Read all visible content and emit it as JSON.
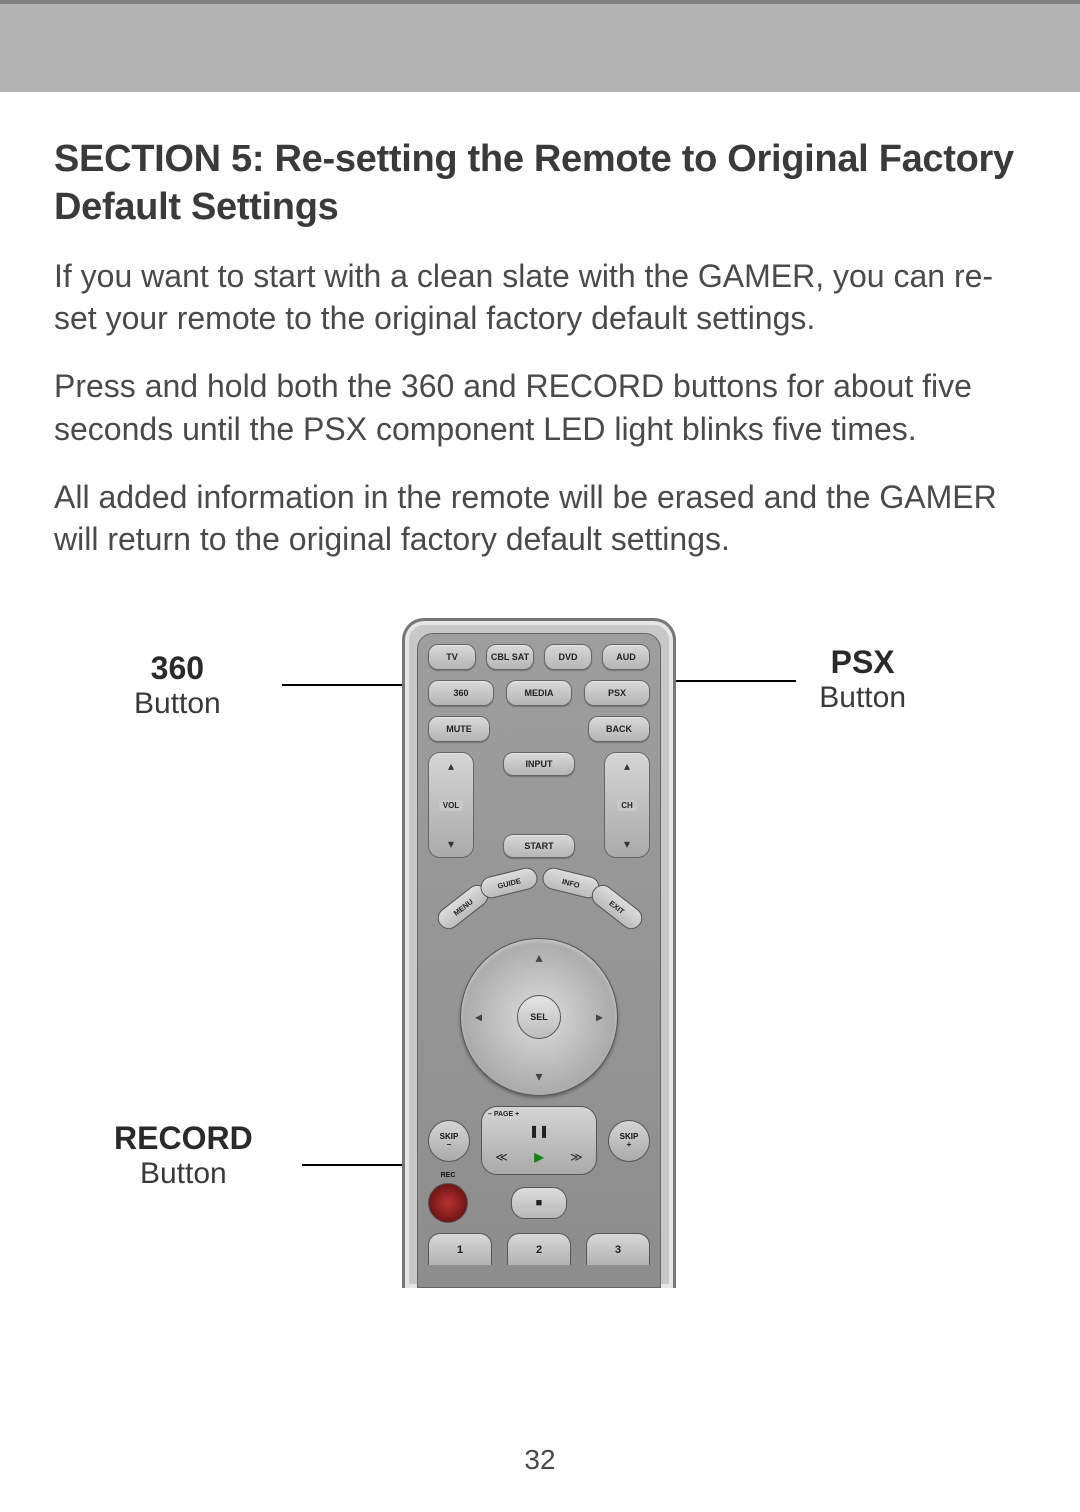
{
  "heading": "SECTION 5: Re-setting the Remote to Original Factory Default Settings",
  "para1": "If you want to start with a clean slate with the GAMER, you can re-set your remote to the original factory default settings.",
  "para2": "Press and hold both the 360 and RECORD buttons for about five seconds until the PSX component LED light blinks five times.",
  "para3": "All added information in the remote will be erased and the GAMER will return to the original factory default settings.",
  "callouts": {
    "c360_bold": "360",
    "c360_reg": "Button",
    "psx_bold": "PSX",
    "psx_reg": "Button",
    "rec_bold": "RECORD",
    "rec_reg": "Button"
  },
  "remote": {
    "row1": {
      "tv": "TV",
      "cblsat": "CBL SAT",
      "dvd": "DVD",
      "aud": "AUD"
    },
    "row2": {
      "b360": "360",
      "media": "MEDIA",
      "psx": "PSX"
    },
    "row3": {
      "mute": "MUTE",
      "back": "BACK"
    },
    "mid": {
      "vol": "VOL",
      "ch": "CH",
      "input": "INPUT",
      "start": "START"
    },
    "pills": {
      "menu": "MENU",
      "guide": "GUIDE",
      "info": "INFO",
      "exit": "EXIT"
    },
    "dpad": {
      "sel": "SEL"
    },
    "skip": {
      "minus_top": "SKIP",
      "minus_bot": "–",
      "plus_top": "SKIP",
      "plus_bot": "+"
    },
    "transport": {
      "page_minus": "–  PAGE  +",
      "pause": "❚❚",
      "play": "▶",
      "rw": "≪",
      "ff": "≫",
      "stop": "■"
    },
    "rec": "REC",
    "nums": {
      "n1": "1",
      "n2": "2",
      "n3": "3"
    }
  },
  "page_number": "32"
}
